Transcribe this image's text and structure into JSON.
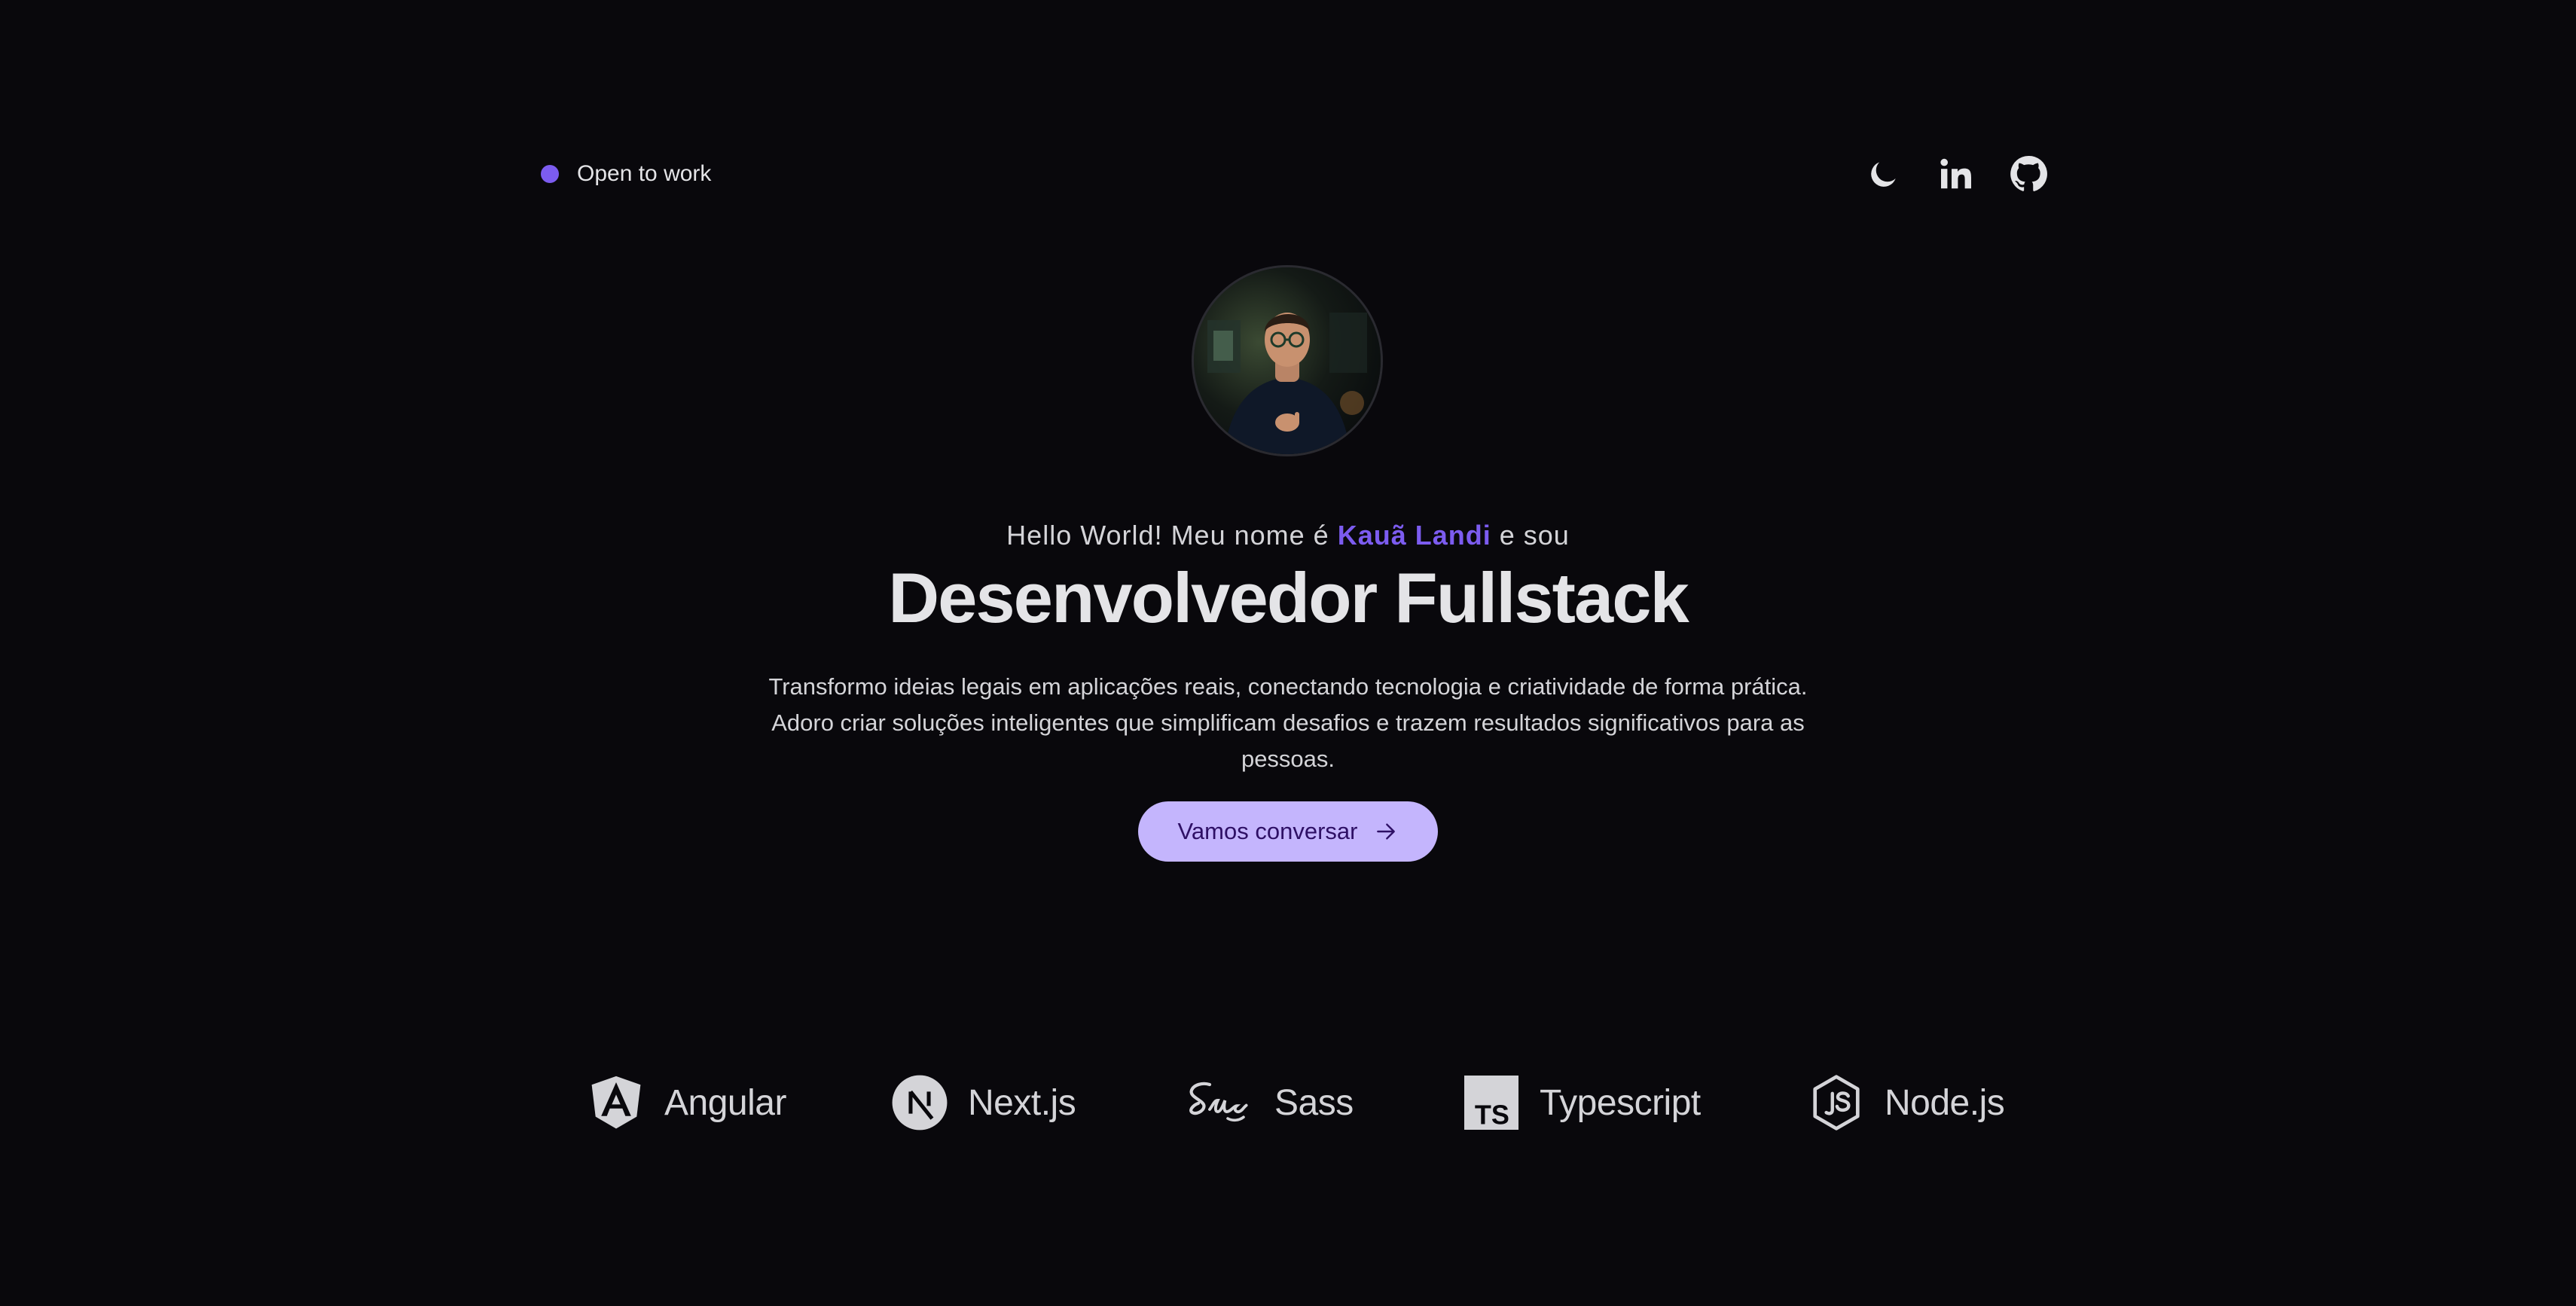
{
  "header": {
    "status_text": "Open to work",
    "status_color": "#7c5cf0",
    "social_icons": [
      "moon-icon",
      "linkedin-icon",
      "github-icon"
    ]
  },
  "hero": {
    "greeting_prefix": "Hello World! Meu nome é",
    "name": "Kauã Landi",
    "greeting_suffix": "e sou",
    "headline": "Desenvolvedor Fullstack",
    "description": "Transformo ideias legais em aplicações reais, conectando tecnologia e criatividade de forma prática. Adoro criar soluções inteligentes que simplificam desafios e trazem resultados significativos para as pessoas.",
    "cta_label": "Vamos conversar",
    "cta_icon": "arrow-right-icon",
    "accent_color": "#7c5cf0",
    "cta_color": "#c4b5fd"
  },
  "stack": {
    "items": [
      {
        "label": "Angular",
        "icon": "angular-icon"
      },
      {
        "label": "Next.js",
        "icon": "nextjs-icon"
      },
      {
        "label": "Sass",
        "icon": "sass-icon"
      },
      {
        "label": "Typescript",
        "icon": "typescript-icon"
      },
      {
        "label": "Node.js",
        "icon": "nodejs-icon"
      }
    ]
  }
}
